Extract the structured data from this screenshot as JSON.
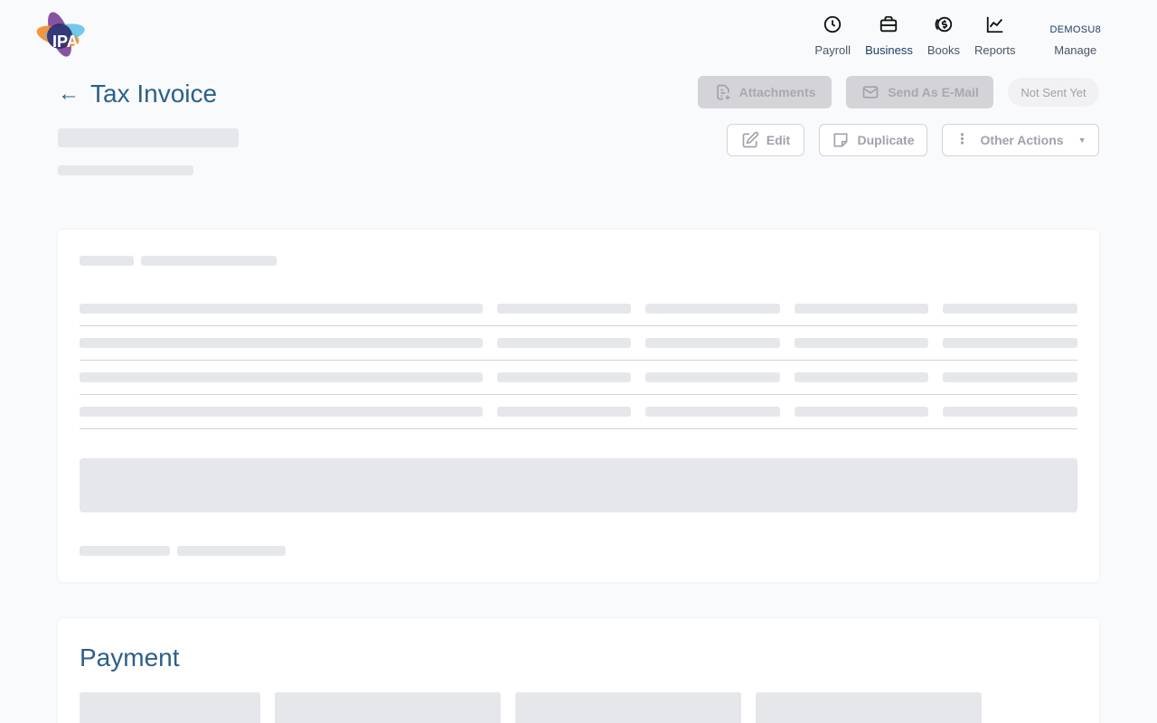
{
  "brand": {
    "logo_text": "IPA"
  },
  "nav": {
    "items": [
      {
        "label": "Payroll",
        "icon": "clock-icon",
        "active": false
      },
      {
        "label": "Business",
        "icon": "briefcase-icon",
        "active": true
      },
      {
        "label": "Books",
        "icon": "dollar-coin-icon",
        "active": false
      },
      {
        "label": "Reports",
        "icon": "line-chart-icon",
        "active": false
      }
    ],
    "account": {
      "company": "DEMOSU8",
      "label": "Manage"
    }
  },
  "page": {
    "title": "Tax Invoice",
    "back_icon": "arrow-left-icon"
  },
  "actions": {
    "attachments": "Attachments",
    "send_email": "Send As E-Mail",
    "status": "Not Sent Yet",
    "edit": "Edit",
    "duplicate": "Duplicate",
    "other_actions": "Other Actions"
  },
  "payment": {
    "title": "Payment"
  },
  "colors": {
    "accent": "#2c5f8a",
    "skeleton": "#e5e7eb",
    "disabled_text": "#a1a1aa"
  }
}
